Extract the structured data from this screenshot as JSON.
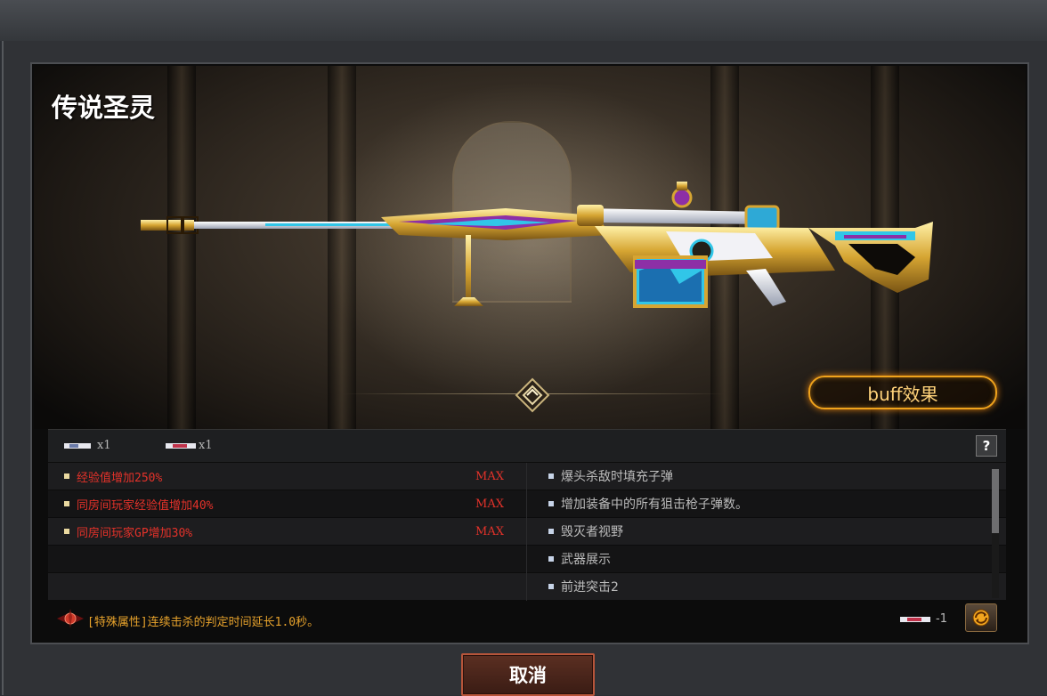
{
  "weapon": {
    "name": "传说圣灵"
  },
  "buff_button": {
    "label": "buff效果"
  },
  "slots": [
    {
      "icon": "ammo-slot-icon-white",
      "count": "x1"
    },
    {
      "icon": "ammo-slot-icon-red",
      "count": "x1"
    }
  ],
  "help_button": {
    "label": "?"
  },
  "attributes_left": [
    {
      "text": "经验值增加250%",
      "level": "MAX"
    },
    {
      "text": "同房间玩家经验值增加40%",
      "level": "MAX"
    },
    {
      "text": "同房间玩家GP增加30%",
      "level": "MAX"
    }
  ],
  "attributes_right": [
    {
      "text": "爆头杀敌时填充子弹"
    },
    {
      "text": "增加装备中的所有狙击枪子弹数。"
    },
    {
      "text": "毁灭者视野"
    },
    {
      "text": "武器展示"
    },
    {
      "text": "前进突击2"
    }
  ],
  "special": {
    "text": "[特殊属性]连续击杀的判定时间延长1.0秒。"
  },
  "cost": {
    "icon": "ammo-slot-icon-red",
    "value": "-1"
  },
  "cancel_button": {
    "label": "取消"
  },
  "colors": {
    "attr_red": "#e4322a",
    "special_orange": "#e8a32c",
    "buff_border": "#f0a31c",
    "cancel_border": "#b7553a"
  }
}
